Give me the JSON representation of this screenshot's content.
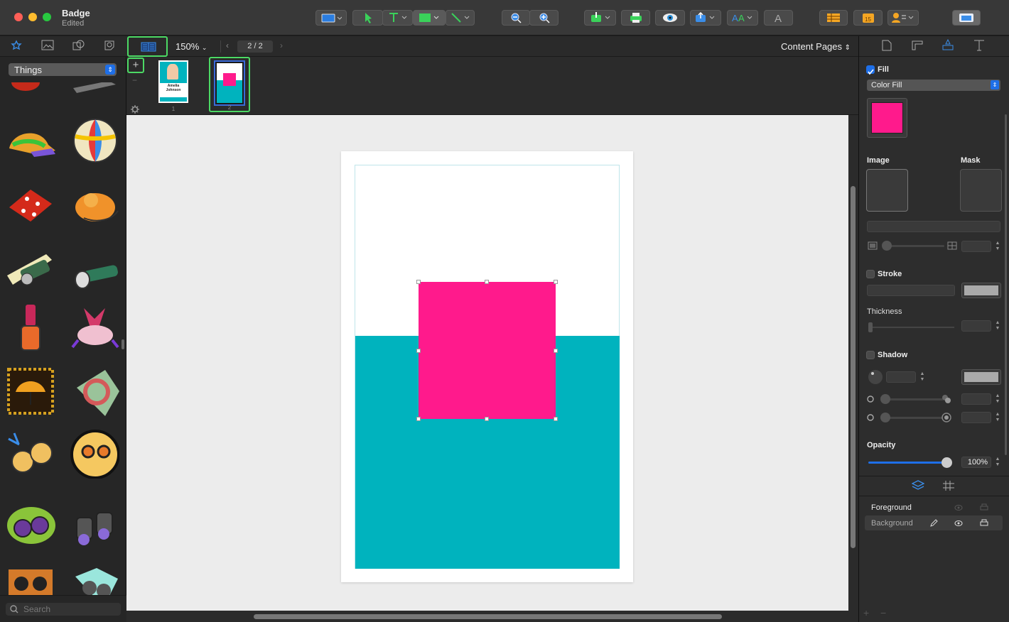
{
  "window": {
    "title": "Badge",
    "subtitle": "Edited"
  },
  "toolbar": {
    "zoom": "150%",
    "page_indicator": "2 / 2",
    "page_scope": "Content Pages"
  },
  "sidebar": {
    "category": "Things",
    "search_placeholder": "Search"
  },
  "thumbnails": [
    {
      "number": "1",
      "name_line1": "Amelia",
      "name_line2": "Johnson"
    },
    {
      "number": "2"
    }
  ],
  "inspector": {
    "fill_label": "Fill",
    "fill_type": "Color Fill",
    "fill_color": "#ff1a8c",
    "image_label": "Image",
    "mask_label": "Mask",
    "stroke_label": "Stroke",
    "thickness_label": "Thickness",
    "shadow_label": "Shadow",
    "opacity_label": "Opacity",
    "opacity_value": "100%"
  },
  "layers": [
    {
      "name": "Foreground"
    },
    {
      "name": "Background"
    }
  ],
  "colors": {
    "accent": "#1e6fe8",
    "highlight": "#4cd964",
    "teal": "#00b3be",
    "pink": "#ff1a8c"
  }
}
